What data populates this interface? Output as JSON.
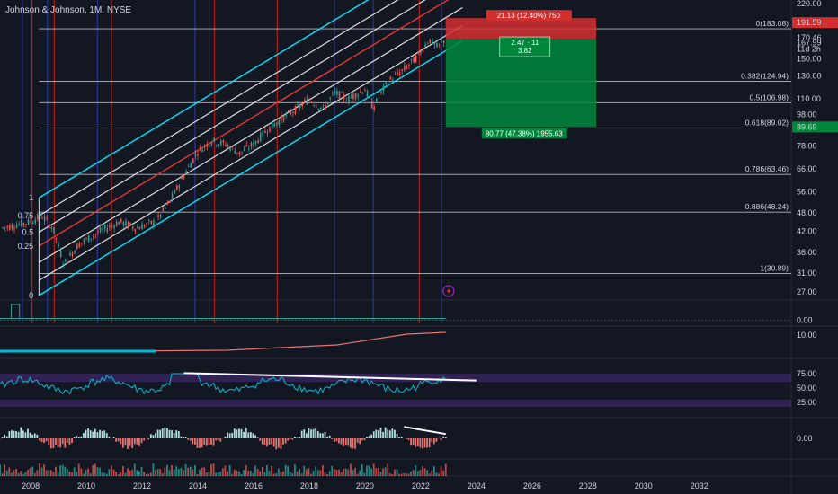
{
  "header": {
    "ticker": "Johnson & Johnson, 1M, NYSE"
  },
  "colors": {
    "background": "#131722",
    "text": "#d1d4dc",
    "candle_up": "#26a69a",
    "candle_down": "#ef5350",
    "vline_red": "#b71c1c",
    "vline_blue": "#283593",
    "channel_cyan": "#00e5ff",
    "channel_white": "#e0e0e0",
    "channel_red": "#e53935",
    "stop_red": "#d32f2f",
    "target_green": "#00873c",
    "rsi_line": "#00bcd4",
    "rsi_band": "#4a2c80"
  },
  "price_axis": {
    "ticks": [
      "220.00",
      "170.46",
      "167.99",
      "11d 2h",
      "150.00",
      "130.00",
      "110.00",
      "98.00",
      "78.00",
      "66.00",
      "56.00",
      "48.00",
      "42.00",
      "36.00",
      "31.00",
      "27.00"
    ],
    "scale": "log"
  },
  "price_tags": [
    {
      "label": "191.59",
      "color": "#d32f2f"
    },
    {
      "label": "89.69",
      "color": "#00873c"
    }
  ],
  "time_axis": {
    "ticks": [
      "2008",
      "2010",
      "2012",
      "2014",
      "2016",
      "2018",
      "2020",
      "2022",
      "2024",
      "2026",
      "2028",
      "2030",
      "2032"
    ]
  },
  "fib_retracement": [
    {
      "label": "0(183.08)",
      "price": 183.08
    },
    {
      "label": "0.382(124.94)",
      "price": 124.94
    },
    {
      "label": "0.5(106.98)",
      "price": 106.98
    },
    {
      "label": "0.618(89.02)",
      "price": 89.02
    },
    {
      "label": "0.786(63.46)",
      "price": 63.46
    },
    {
      "label": "0.886(48.24)",
      "price": 48.24
    },
    {
      "label": "1(30.89)",
      "price": 30.89
    }
  ],
  "pitchfork_labels": [
    "1",
    "0.75",
    "0.5",
    "0.25",
    "0"
  ],
  "position_tool": {
    "risk_label": "21.13 (12.40%) 750",
    "ratio_label": "2.47 · 11",
    "ratio_sub": "3.82",
    "reward_label": "80.77 (47.38%) 1955.63"
  },
  "indicators": {
    "panel1": {
      "tick": "0.00"
    },
    "panel2": {
      "tick": "10.00"
    },
    "rsi": {
      "ticks": [
        "75.00",
        "50.00",
        "25.00"
      ]
    },
    "macd": {
      "tick": "0.00"
    }
  },
  "chart_data": {
    "type": "candlestick",
    "title": "Johnson & Johnson, 1M, NYSE",
    "x": {
      "start": 2006.9,
      "end": 2035.3,
      "ticks": [
        2008,
        2010,
        2012,
        2014,
        2016,
        2018,
        2020,
        2022,
        2024,
        2026,
        2028,
        2030,
        2032
      ]
    },
    "y": {
      "scale": "log",
      "min": 27,
      "max": 220
    },
    "price_path": [
      [
        2007.0,
        43
      ],
      [
        2007.5,
        44
      ],
      [
        2008.0,
        45
      ],
      [
        2008.4,
        47
      ],
      [
        2008.8,
        43
      ],
      [
        2009.2,
        33
      ],
      [
        2009.7,
        38
      ],
      [
        2010.5,
        42
      ],
      [
        2011.2,
        45
      ],
      [
        2011.8,
        43
      ],
      [
        2012.5,
        45
      ],
      [
        2013.0,
        52
      ],
      [
        2013.5,
        63
      ],
      [
        2014.0,
        75
      ],
      [
        2014.5,
        81
      ],
      [
        2015.0,
        79
      ],
      [
        2015.5,
        74
      ],
      [
        2016.0,
        79
      ],
      [
        2016.5,
        88
      ],
      [
        2017.0,
        95
      ],
      [
        2017.6,
        103
      ],
      [
        2018.0,
        110
      ],
      [
        2018.5,
        102
      ],
      [
        2018.9,
        115
      ],
      [
        2019.4,
        110
      ],
      [
        2020.0,
        118
      ],
      [
        2020.3,
        103
      ],
      [
        2020.8,
        124
      ],
      [
        2021.4,
        136
      ],
      [
        2021.9,
        150
      ],
      [
        2022.3,
        170
      ],
      [
        2022.6,
        160
      ],
      [
        2022.9,
        170
      ]
    ],
    "vertical_markers": {
      "red": [
        2008.05,
        2008.85,
        2010.9,
        2014.6,
        2016.85,
        2021.95
      ],
      "blue": [
        2007.7,
        2008.6,
        2010.4,
        2013.9,
        2018.9,
        2020.3,
        2022.75
      ]
    },
    "position": {
      "entry": 170.46,
      "stop": 191.59,
      "target": 89.69,
      "start": 2022.9,
      "end": 2028.3
    },
    "rsi_trendline": [
      [
        2013.5,
        76
      ],
      [
        2024.0,
        63
      ]
    ],
    "macd_trendline": [
      [
        2021.4,
        8
      ],
      [
        2022.9,
        3
      ]
    ]
  }
}
